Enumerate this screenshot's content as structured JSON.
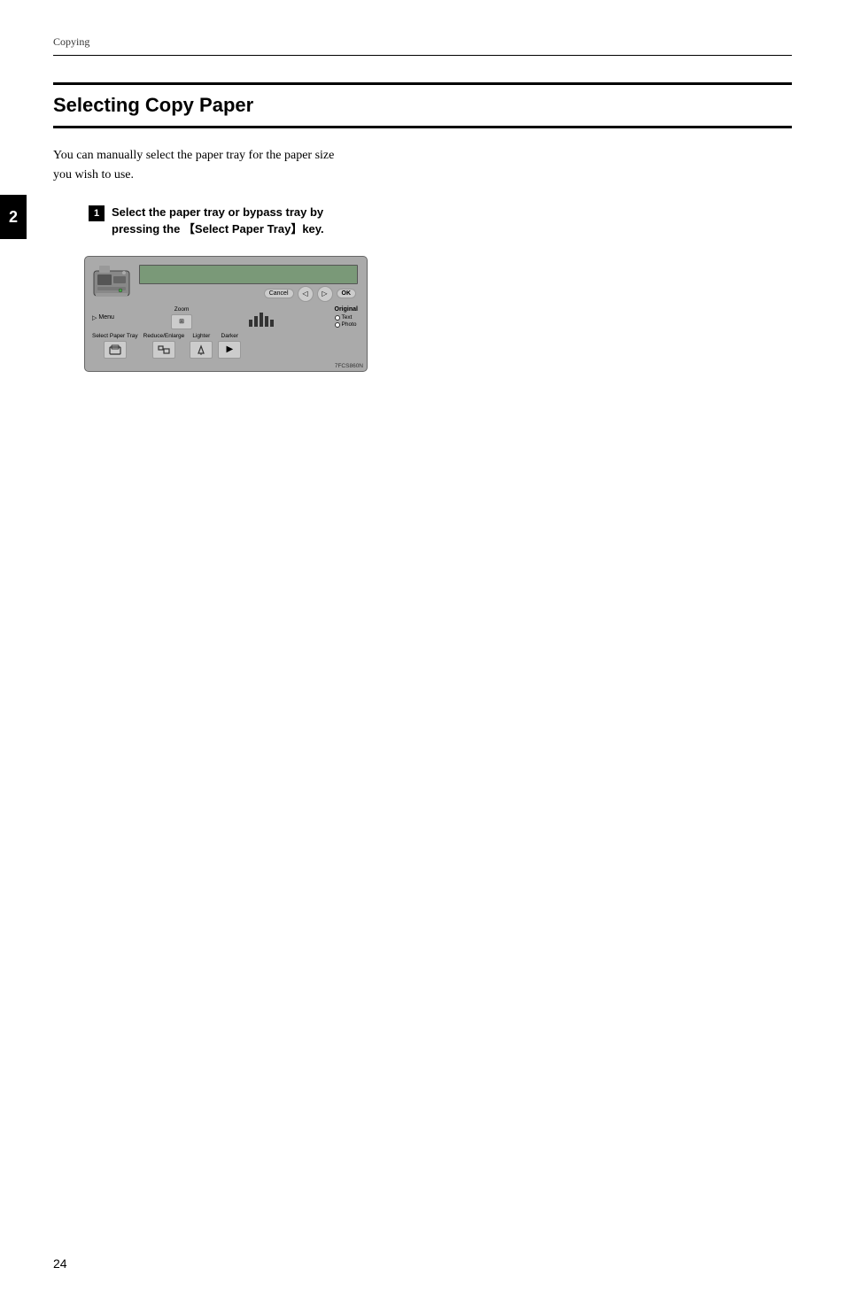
{
  "page": {
    "breadcrumb": "Copying",
    "chapter_number": "2",
    "page_number": "24",
    "section_title": "Selecting Copy Paper",
    "body_text": "You can manually select the paper tray for the paper size you wish to use.",
    "step1": {
      "number": "1",
      "text": "Select the paper tray or bypass tray by pressing the 【Select Paper Tray】key."
    },
    "figure_id": "7FCS860N"
  },
  "panel": {
    "cancel_label": "Cancel",
    "ok_label": "OK",
    "menu_label": "Menu",
    "zoom_label": "Zoom",
    "select_paper_tray_label": "Select Paper Tray",
    "reduce_enlarge_label": "Reduce/Enlarge",
    "lighter_label": "Lighter",
    "darker_label": "Darker",
    "original_label": "Original",
    "text_label": "Text",
    "photo_label": "Photo",
    "nav_left": "◁",
    "nav_right": "▷",
    "menu_arrow": "▷",
    "darker_arrow": "▶"
  }
}
